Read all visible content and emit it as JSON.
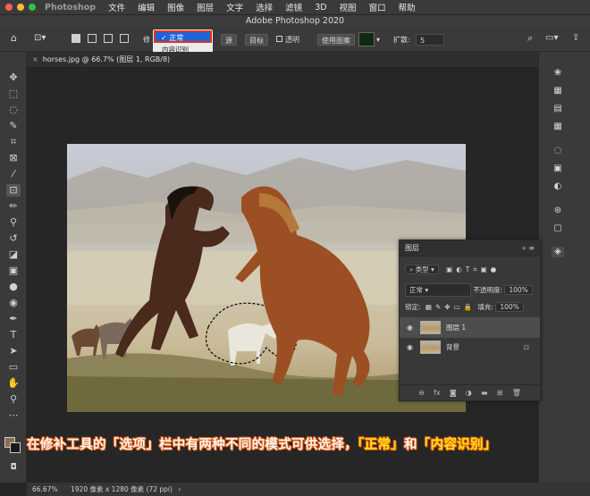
{
  "menubar": {
    "app": "Photoshop",
    "items": [
      "文件",
      "编辑",
      "图像",
      "图层",
      "文字",
      "选择",
      "滤镜",
      "3D",
      "视图",
      "窗口",
      "帮助"
    ]
  },
  "window_title": "Adobe Photoshop 2020",
  "options": {
    "patch_label": "修",
    "mode_selected": "✓ 正常",
    "mode_other": "内容识别",
    "source": "源",
    "target": "目标",
    "transparent": "透明",
    "use_pattern": "使用图案",
    "diffusion_label": "扩散:",
    "diffusion_value": "5"
  },
  "tab": {
    "title": "horses.jpg @ 66.7% (图层 1, RGB/8)"
  },
  "layers_panel": {
    "title": "图层",
    "kind": "类型",
    "blend_mode": "正常",
    "opacity_label": "不透明度:",
    "opacity": "100%",
    "lock_label": "锁定:",
    "fill_label": "填充:",
    "fill": "100%",
    "layers": [
      {
        "name": "图层 1",
        "selected": true
      },
      {
        "name": "背景",
        "selected": false
      }
    ]
  },
  "caption": {
    "part1": "在修补工具的「选项」栏中有两种不同的模式可供选择，",
    "part2": "「正常」",
    "part3": "和",
    "part4": "「内容识别」"
  },
  "status": {
    "zoom": "66.67%",
    "doc_info": "1920 像素 x 1280 像素 (72 ppi)"
  },
  "colors": {
    "foreground": "#8b6e4c",
    "background": "#1a1a1a",
    "highlight": "#1f63d6",
    "annotation": "#e1341e"
  }
}
